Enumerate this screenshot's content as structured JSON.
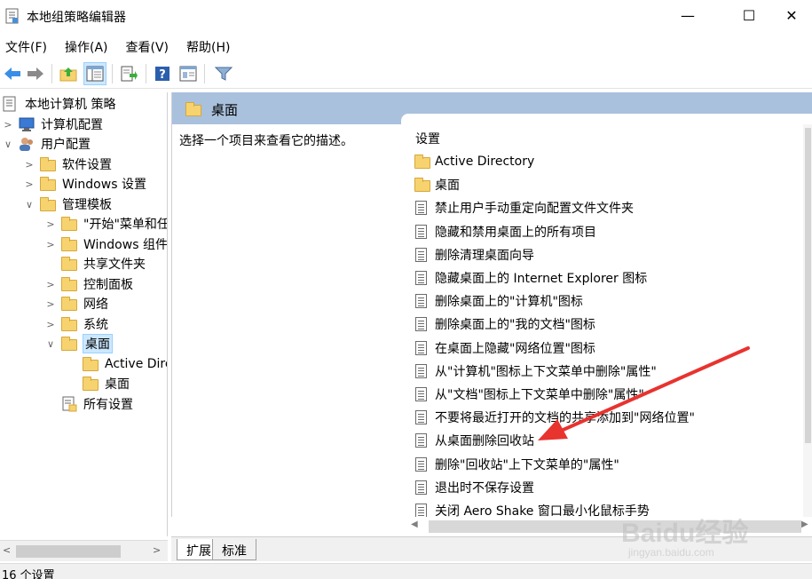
{
  "window": {
    "title": "本地组策略编辑器",
    "min_label": "—",
    "max_label": "☐",
    "close_label": "✕"
  },
  "menu": [
    "文件(F)",
    "操作(A)",
    "查看(V)",
    "帮助(H)"
  ],
  "toolbar": {
    "icons": [
      "back-arrow-icon",
      "forward-arrow-icon",
      "up-folder-icon",
      "show-hide-tree-icon",
      "export-list-icon",
      "help-icon",
      "properties-icon",
      "filter-icon"
    ]
  },
  "tree": {
    "root": "本地计算机 策略",
    "computer_config": "计算机配置",
    "user_config": "用户配置",
    "software_settings": "软件设置",
    "windows_settings": "Windows 设置",
    "admin_templates": "管理模板",
    "start_menu": "\"开始\"菜单和任",
    "windows_components": "Windows 组件",
    "shared_folders": "共享文件夹",
    "control_panel": "控制面板",
    "network": "网络",
    "system": "系统",
    "desktop": "桌面",
    "active_directory": "Active Directory",
    "desktop_sub": "桌面",
    "all_settings": "所有设置"
  },
  "pane": {
    "header_title": "桌面",
    "description": "选择一个项目来查看它的描述。",
    "column_header": "设置",
    "items": [
      {
        "type": "folder",
        "label": "Active Directory"
      },
      {
        "type": "folder",
        "label": "桌面"
      },
      {
        "type": "setting",
        "label": "禁止用户手动重定向配置文件文件夹"
      },
      {
        "type": "setting",
        "label": "隐藏和禁用桌面上的所有项目"
      },
      {
        "type": "setting",
        "label": "删除清理桌面向导"
      },
      {
        "type": "setting",
        "label": "隐藏桌面上的 Internet Explorer 图标"
      },
      {
        "type": "setting",
        "label": "删除桌面上的\"计算机\"图标"
      },
      {
        "type": "setting",
        "label": "删除桌面上的\"我的文档\"图标"
      },
      {
        "type": "setting",
        "label": "在桌面上隐藏\"网络位置\"图标"
      },
      {
        "type": "setting",
        "label": "从\"计算机\"图标上下文菜单中删除\"属性\""
      },
      {
        "type": "setting",
        "label": "从\"文档\"图标上下文菜单中删除\"属性\""
      },
      {
        "type": "setting",
        "label": "不要将最近打开的文档的共享添加到\"网络位置\""
      },
      {
        "type": "setting",
        "label": "从桌面删除回收站"
      },
      {
        "type": "setting",
        "label": "删除\"回收站\"上下文菜单的\"属性\""
      },
      {
        "type": "setting",
        "label": "退出时不保存设置"
      },
      {
        "type": "setting",
        "label": "关闭 Aero Shake 窗口最小化鼠标手势"
      }
    ]
  },
  "tabs": [
    "扩展",
    "标准"
  ],
  "status": "16 个设置",
  "watermark": {
    "text": "Baidu经验",
    "sub": "jingyan.baidu.com"
  },
  "colors": {
    "header_bg": "#a9c1dd",
    "selection": "#cce8ff",
    "arrow": "#e8332f"
  }
}
